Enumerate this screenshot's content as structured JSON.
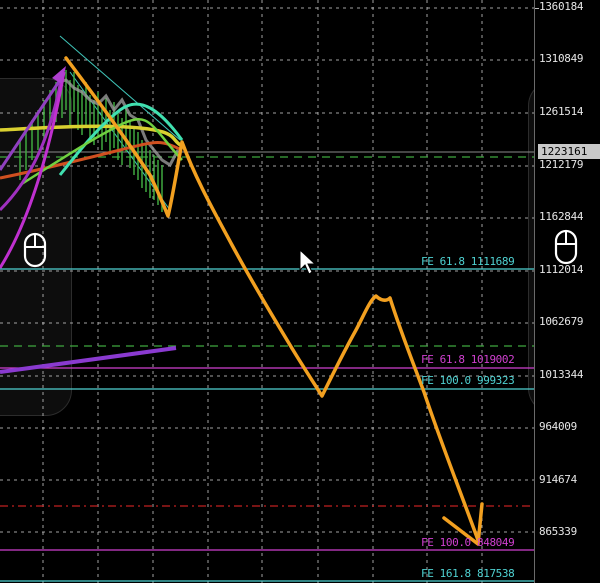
{
  "price_axis": {
    "labels": [
      "1360184",
      "1310849",
      "1261514",
      "1212179",
      "1162844",
      "1112014",
      "1062679",
      "1013344",
      "964009",
      "914674",
      "865339"
    ],
    "current_price": "1223161"
  },
  "levels": [
    {
      "label": "FE 61.8 1111689",
      "color": "#4fd2d2"
    },
    {
      "label": "FE 61.8 1019002",
      "color": "#d040d0"
    },
    {
      "label": "FE 100.0 999323",
      "color": "#4fd2d2"
    },
    {
      "label": "FE 100.0 848049",
      "color": "#d040d0"
    },
    {
      "label": "FE 161.8 817538",
      "color": "#4fd2d2"
    }
  ],
  "colors": {
    "background": "#000000",
    "grid": "#bfbfbf",
    "cyan_level": "#4fd2d2",
    "magenta_level": "#d040d0",
    "orange_drawing": "#f2a020",
    "green_dashed": "#3fa83f",
    "red_dashdot": "#c02020"
  },
  "icons": {
    "left_panel": "mouse-icon",
    "right_panel": "mouse-icon",
    "pointer": "arrow-cursor-icon"
  }
}
